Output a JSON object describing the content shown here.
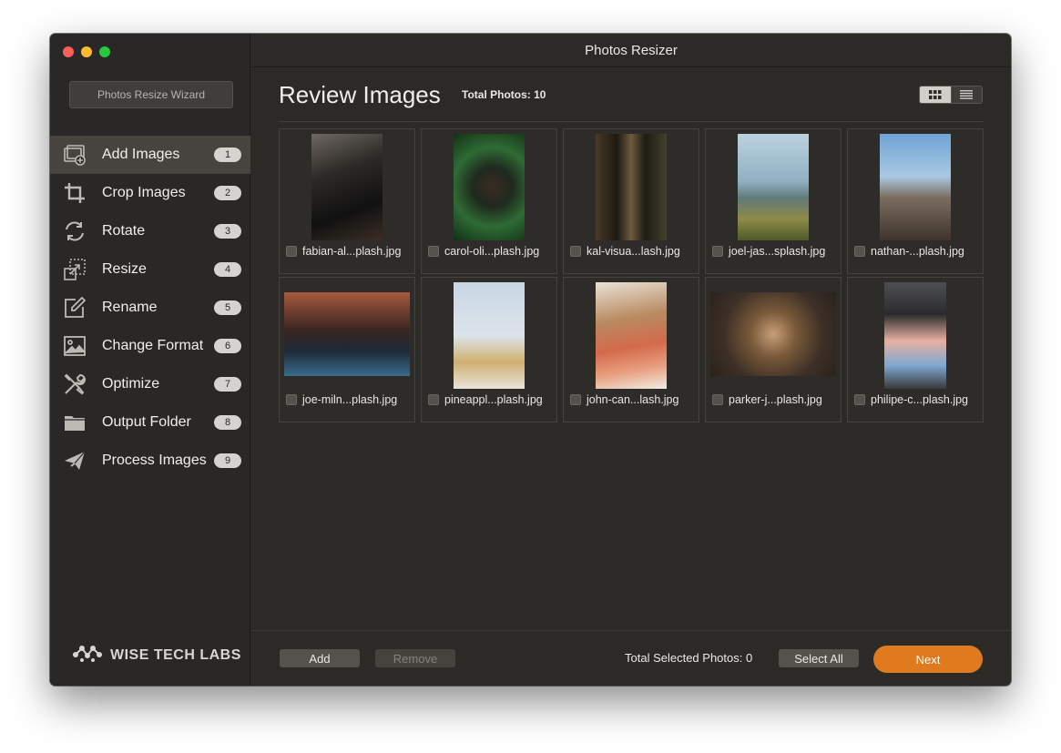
{
  "window": {
    "title": "Photos Resizer"
  },
  "sidebar": {
    "wizard_button": "Photos Resize Wizard",
    "items": [
      {
        "label": "Add Images",
        "badge": "1",
        "icon": "add-images-icon"
      },
      {
        "label": "Crop Images",
        "badge": "2",
        "icon": "crop-icon"
      },
      {
        "label": "Rotate",
        "badge": "3",
        "icon": "rotate-icon"
      },
      {
        "label": "Resize",
        "badge": "4",
        "icon": "resize-icon"
      },
      {
        "label": "Rename",
        "badge": "5",
        "icon": "rename-icon"
      },
      {
        "label": "Change Format",
        "badge": "6",
        "icon": "image-format-icon"
      },
      {
        "label": "Optimize",
        "badge": "7",
        "icon": "tools-icon"
      },
      {
        "label": "Output Folder",
        "badge": "8",
        "icon": "folder-icon"
      },
      {
        "label": "Process Images",
        "badge": "9",
        "icon": "paper-plane-icon"
      }
    ],
    "brand": "WISE TECH LABS"
  },
  "main": {
    "title": "Review Images",
    "total_photos": "Total Photos: 10",
    "photos": [
      {
        "name": "fabian-al...plash.jpg"
      },
      {
        "name": "carol-oli...plash.jpg"
      },
      {
        "name": "kal-visua...lash.jpg"
      },
      {
        "name": "joel-jas...splash.jpg"
      },
      {
        "name": "nathan-...plash.jpg"
      },
      {
        "name": "joe-miln...plash.jpg"
      },
      {
        "name": "pineappl...plash.jpg"
      },
      {
        "name": "john-can...lash.jpg"
      },
      {
        "name": "parker-j...plash.jpg"
      },
      {
        "name": "philipe-c...plash.jpg"
      }
    ]
  },
  "footer": {
    "add": "Add",
    "remove": "Remove",
    "selected": "Total Selected Photos: 0",
    "select_all": "Select All",
    "next": "Next"
  },
  "colors": {
    "accent": "#e07a1f",
    "sidebar_active": "#47443f",
    "background": "#2c2a27"
  }
}
